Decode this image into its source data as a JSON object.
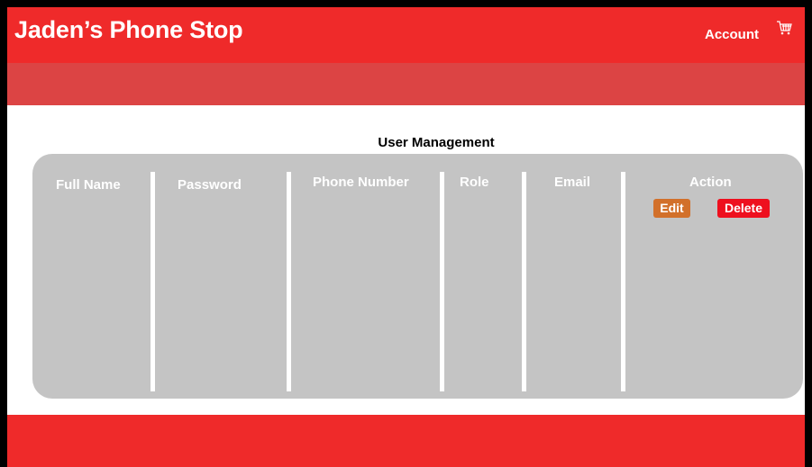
{
  "header": {
    "brand": "Jaden’s Phone Stop",
    "account_label": "Account",
    "cart_icon": "cart-icon"
  },
  "page": {
    "title": "User Management"
  },
  "table": {
    "columns": [
      "Full Name",
      "Password",
      "Phone Number",
      "Role",
      "Email",
      "Action"
    ],
    "actions": {
      "edit_label": "Edit",
      "delete_label": "Delete"
    }
  },
  "colors": {
    "header": "#ef2a2a",
    "subbar": "#dc4444",
    "panel": "#c4c4c4",
    "edit": "#d2702a",
    "delete": "#ee0f1e"
  }
}
